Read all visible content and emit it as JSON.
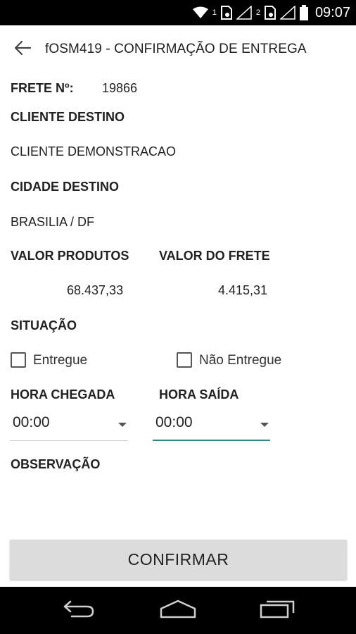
{
  "status_bar": {
    "time": "09:07",
    "sim1_label": "1",
    "sim2_label": "2",
    "icons": [
      "wifi-icon",
      "sim1-icon",
      "signal-icon",
      "sim2-icon",
      "signal-icon",
      "battery-icon"
    ]
  },
  "app_bar": {
    "title": "fOSM419 - CONFIRMAÇÃO DE ENTREGA",
    "back_icon": "arrow-left-icon"
  },
  "form": {
    "frete_label": "FRETE Nº:",
    "frete_value": "19866",
    "cliente_label": "CLIENTE DESTINO",
    "cliente_value": "CLIENTE DEMONSTRACAO",
    "cidade_label": "CIDADE DESTINO",
    "cidade_value": "BRASILIA / DF",
    "valor_produtos_label": "VALOR PRODUTOS",
    "valor_produtos_value": "68.437,33",
    "valor_frete_label": "VALOR DO FRETE",
    "valor_frete_value": "4.415,31",
    "situacao_label": "SITUAÇÃO",
    "entregue_label": "Entregue",
    "entregue_checked": false,
    "nao_entregue_label": "Não Entregue",
    "nao_entregue_checked": false,
    "hora_chegada_label": "HORA CHEGADA",
    "hora_chegada_value": "00:00",
    "hora_saida_label": "HORA SAÍDA",
    "hora_saida_value": "00:00",
    "observacao_label": "OBSERVAÇÃO",
    "observacao_value": ""
  },
  "actions": {
    "confirm_label": "CONFIRMAR"
  },
  "colors": {
    "accent": "#2a8a83",
    "button_bg": "#dcdcdc",
    "bar_bg": "#000000"
  },
  "nav_bar": {
    "icons": [
      "back-nav-icon",
      "home-nav-icon",
      "recents-nav-icon"
    ]
  }
}
